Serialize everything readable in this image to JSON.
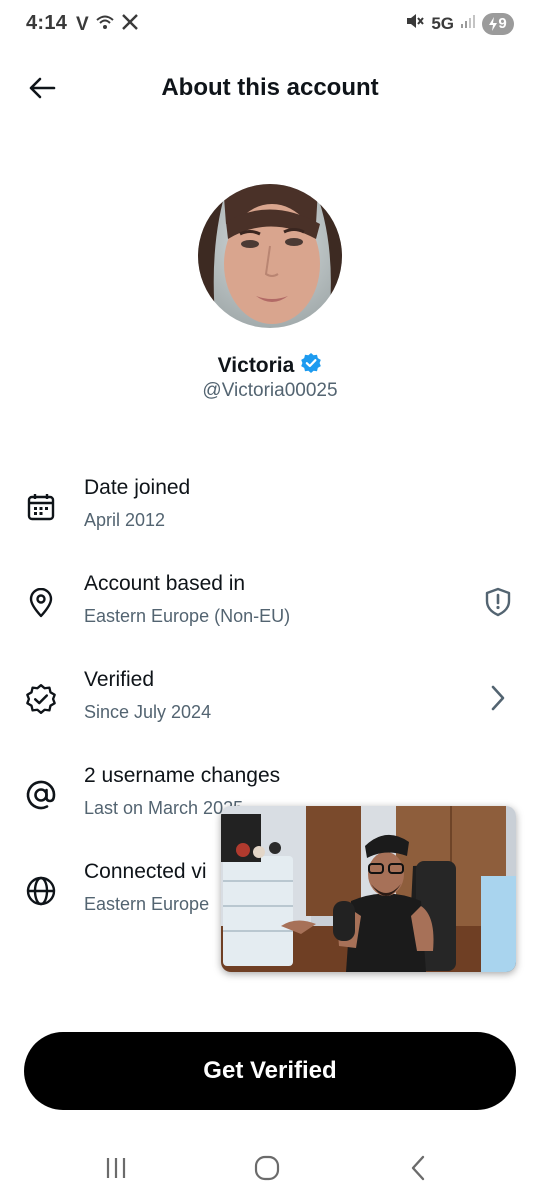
{
  "status_bar": {
    "time": "4:14",
    "carrier_icon": "V",
    "network": "5G",
    "battery_level": "9",
    "icons": [
      "carrier-v-icon",
      "wifi-icon",
      "x-logo-icon",
      "mute-icon",
      "signal-icon",
      "battery-charging-icon"
    ]
  },
  "header": {
    "title": "About this account",
    "back_icon": "back-arrow-icon"
  },
  "profile": {
    "display_name": "Victoria",
    "handle": "@Victoria00025",
    "verified_badge_color": "#1d9bf0",
    "avatar": "profile-photo"
  },
  "info": {
    "date_joined": {
      "label": "Date joined",
      "value": "April 2012",
      "icon": "calendar-icon"
    },
    "account_based": {
      "label": "Account based in",
      "value": "Eastern Europe (Non-EU)",
      "icon": "location-pin-icon",
      "right_icon": "shield-alert-icon"
    },
    "verified": {
      "label": "Verified",
      "value": "Since July 2024",
      "icon": "verified-badge-outline-icon",
      "right_icon": "chevron-right-icon"
    },
    "username_changes": {
      "label": "2 username changes",
      "value": "Last on March 2025",
      "icon": "at-sign-icon"
    },
    "connected_via": {
      "label": "Connected vi",
      "value": "Eastern Europe",
      "icon": "globe-icon"
    }
  },
  "video_overlay": {
    "icon": "picture-in-picture-video"
  },
  "cta": {
    "label": "Get Verified"
  },
  "nav": {
    "icons": [
      "recent-apps-icon",
      "home-icon",
      "back-icon"
    ]
  },
  "colors": {
    "primary_text": "#0f1419",
    "secondary_text": "#536471",
    "verified_blue": "#1d9bf0",
    "button_bg": "#000000"
  }
}
